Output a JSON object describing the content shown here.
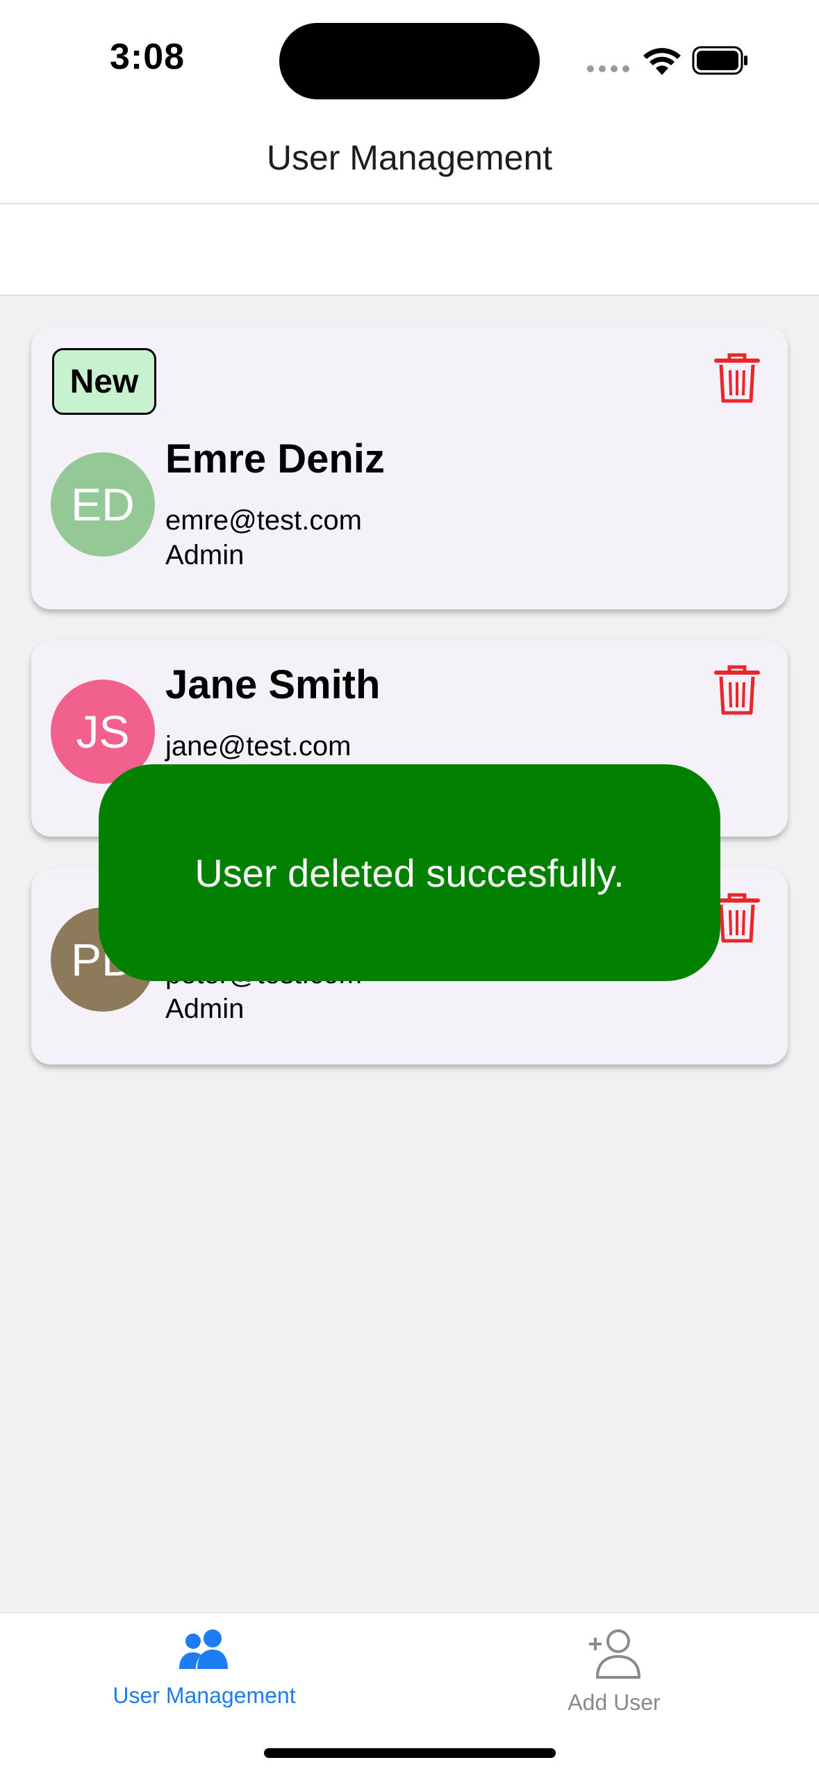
{
  "status_bar": {
    "time": "3:08"
  },
  "header": {
    "title": "User Management"
  },
  "users": [
    {
      "badge": "New",
      "initials": "ED",
      "name": "Emre Deniz",
      "email": "emre@test.com",
      "role": "Admin",
      "avatar_color": "#94c896"
    },
    {
      "initials": "JS",
      "name": "Jane Smith",
      "email": "jane@test.com",
      "role": "",
      "avatar_color": "#f2608e"
    },
    {
      "initials": "PD",
      "name": "",
      "email": "peter@test.com",
      "role": "Admin",
      "avatar_color": "#8c7a5a"
    }
  ],
  "toast": {
    "message": "User deleted succesfully.",
    "color": "#028000"
  },
  "tabbar": {
    "tabs": [
      {
        "label": "User Management",
        "icon": "users-icon",
        "active": true
      },
      {
        "label": "Add User",
        "icon": "add-user-icon",
        "active": false
      }
    ]
  },
  "colors": {
    "accent": "#1e7cf2",
    "delete": "#e8262b",
    "card_bg": "#f5f1f8",
    "badge_bg": "#c8f1d0"
  }
}
